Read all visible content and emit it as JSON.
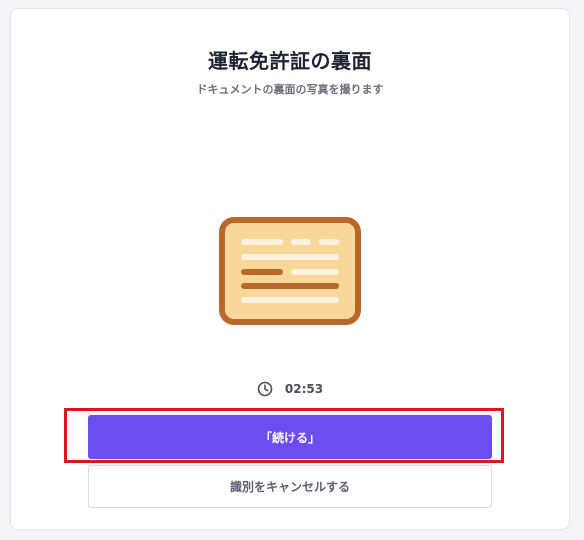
{
  "header": {
    "title": "運転免許証の裏面",
    "subtitle": "ドキュメントの裏面の写真を撮ります"
  },
  "illustration": {
    "icon": "id-card-back-icon",
    "colors": {
      "frame": "#b8692a",
      "fill": "#f7d79a",
      "light_line": "#fdf3de",
      "dark_line": "#b8692a"
    }
  },
  "timer": {
    "icon": "clock-icon",
    "value": "02:53"
  },
  "actions": {
    "continue_label": "「続ける」",
    "cancel_label": "識別をキャンセルする"
  },
  "colors": {
    "accent": "#6b4ef0",
    "highlight": "#e0141e"
  }
}
